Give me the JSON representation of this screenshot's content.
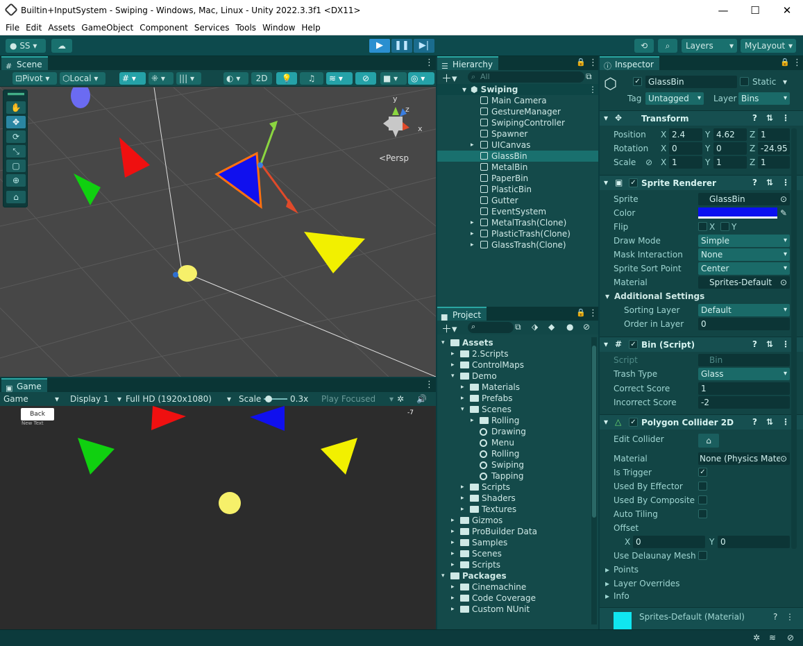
{
  "window": {
    "title": "Builtin+InputSystem - Swiping - Windows, Mac, Linux - Unity 2022.3.3f1 <DX11>"
  },
  "menu": [
    "File",
    "Edit",
    "Assets",
    "GameObject",
    "Component",
    "Services",
    "Tools",
    "Window",
    "Help"
  ],
  "toolbar": {
    "account": "SS",
    "layers": "Layers",
    "layout": "MyLayout"
  },
  "scene": {
    "tab": "Scene",
    "pivot": "Pivot",
    "local": "Local",
    "mode2d": "2D",
    "persp": "<Persp",
    "gizmo_axes": {
      "y": "y",
      "z": "z",
      "x": "x"
    }
  },
  "game": {
    "tab": "Game",
    "mode": "Game",
    "display": "Display 1",
    "resolution": "Full HD (1920x1080)",
    "scale_label": "Scale",
    "scale_value": "0.3x",
    "play_focused": "Play Focused",
    "back_button": "Back",
    "new_text": "New Text",
    "score": "-7"
  },
  "hierarchy": {
    "tab": "Hierarchy",
    "search_placeholder": "All",
    "scene_name": "Swiping",
    "items": [
      {
        "label": "Main Camera",
        "expand": false
      },
      {
        "label": "GestureManager",
        "expand": false
      },
      {
        "label": "SwipingController",
        "expand": false
      },
      {
        "label": "Spawner",
        "expand": false
      },
      {
        "label": "UICanvas",
        "expand": true
      },
      {
        "label": "GlassBin",
        "expand": false,
        "selected": true
      },
      {
        "label": "MetalBin",
        "expand": false
      },
      {
        "label": "PaperBin",
        "expand": false
      },
      {
        "label": "PlasticBin",
        "expand": false
      },
      {
        "label": "Gutter",
        "expand": false
      },
      {
        "label": "EventSystem",
        "expand": false
      },
      {
        "label": "MetalTrash(Clone)",
        "expand": true
      },
      {
        "label": "PlasticTrash(Clone)",
        "expand": true
      },
      {
        "label": "GlassTrash(Clone)",
        "expand": true
      }
    ]
  },
  "project": {
    "tab": "Project",
    "items": [
      {
        "label": "Assets",
        "depth": 0,
        "open": true,
        "kind": "folder"
      },
      {
        "label": "2.Scripts",
        "depth": 1,
        "open": false,
        "kind": "folder"
      },
      {
        "label": "ControlMaps",
        "depth": 1,
        "open": false,
        "kind": "folder"
      },
      {
        "label": "Demo",
        "depth": 1,
        "open": true,
        "kind": "folder"
      },
      {
        "label": "Materials",
        "depth": 2,
        "open": false,
        "kind": "folder"
      },
      {
        "label": "Prefabs",
        "depth": 2,
        "open": false,
        "kind": "folder"
      },
      {
        "label": "Scenes",
        "depth": 2,
        "open": true,
        "kind": "folder"
      },
      {
        "label": "Rolling",
        "depth": 3,
        "open": false,
        "kind": "folder"
      },
      {
        "label": "Drawing",
        "depth": 3,
        "open": false,
        "kind": "scene"
      },
      {
        "label": "Menu",
        "depth": 3,
        "open": false,
        "kind": "scene"
      },
      {
        "label": "Rolling",
        "depth": 3,
        "open": false,
        "kind": "scene"
      },
      {
        "label": "Swiping",
        "depth": 3,
        "open": false,
        "kind": "scene"
      },
      {
        "label": "Tapping",
        "depth": 3,
        "open": false,
        "kind": "scene"
      },
      {
        "label": "Scripts",
        "depth": 2,
        "open": false,
        "kind": "folder"
      },
      {
        "label": "Shaders",
        "depth": 2,
        "open": false,
        "kind": "folder"
      },
      {
        "label": "Textures",
        "depth": 2,
        "open": false,
        "kind": "folder"
      },
      {
        "label": "Gizmos",
        "depth": 1,
        "open": false,
        "kind": "folder"
      },
      {
        "label": "ProBuilder Data",
        "depth": 1,
        "open": false,
        "kind": "folder"
      },
      {
        "label": "Samples",
        "depth": 1,
        "open": false,
        "kind": "folder"
      },
      {
        "label": "Scenes",
        "depth": 1,
        "open": false,
        "kind": "folder"
      },
      {
        "label": "Scripts",
        "depth": 1,
        "open": false,
        "kind": "folder"
      },
      {
        "label": "Packages",
        "depth": 0,
        "open": true,
        "kind": "folder"
      },
      {
        "label": "Cinemachine",
        "depth": 1,
        "open": false,
        "kind": "folder"
      },
      {
        "label": "Code Coverage",
        "depth": 1,
        "open": false,
        "kind": "folder"
      },
      {
        "label": "Custom NUnit",
        "depth": 1,
        "open": false,
        "kind": "folder"
      }
    ]
  },
  "inspector": {
    "tab": "Inspector",
    "object_name": "GlassBin",
    "static_label": "Static",
    "tag_label": "Tag",
    "tag_value": "Untagged",
    "layer_label": "Layer",
    "layer_value": "Bins",
    "transform": {
      "title": "Transform",
      "position": {
        "label": "Position",
        "x": "2.4",
        "y": "4.62",
        "z": "1"
      },
      "rotation": {
        "label": "Rotation",
        "x": "0",
        "y": "0",
        "z": "-24.95"
      },
      "scale": {
        "label": "Scale",
        "x": "1",
        "y": "1",
        "z": "1"
      }
    },
    "sprite_renderer": {
      "title": "Sprite Renderer",
      "sprite_label": "Sprite",
      "sprite_value": "GlassBin",
      "color_label": "Color",
      "color": "#0a10f0",
      "flip_label": "Flip",
      "flip_x": "X",
      "flip_y": "Y",
      "draw_mode_label": "Draw Mode",
      "draw_mode": "Simple",
      "mask_label": "Mask Interaction",
      "mask": "None",
      "sort_point_label": "Sprite Sort Point",
      "sort_point": "Center",
      "material_label": "Material",
      "material": "Sprites-Default",
      "additional": "Additional Settings",
      "sorting_layer_label": "Sorting Layer",
      "sorting_layer": "Default",
      "order_label": "Order in Layer",
      "order": "0"
    },
    "bin_script": {
      "title": "Bin (Script)",
      "script_label": "Script",
      "script_value": "Bin",
      "trash_type_label": "Trash Type",
      "trash_type": "Glass",
      "correct_label": "Correct Score",
      "correct": "1",
      "incorrect_label": "Incorrect Score",
      "incorrect": "-2"
    },
    "polygon_collider": {
      "title": "Polygon Collider 2D",
      "edit_label": "Edit Collider",
      "material_label": "Material",
      "material": "None (Physics Mate",
      "is_trigger_label": "Is Trigger",
      "effector_label": "Used By Effector",
      "composite_label": "Used By Composite",
      "auto_tiling_label": "Auto Tiling",
      "offset_label": "Offset",
      "offset_x": "0",
      "offset_y": "0",
      "delaunay_label": "Use Delaunay Mesh",
      "points": "Points",
      "layer_overrides": "Layer Overrides",
      "info": "Info"
    },
    "material_footer": "Sprites-Default (Material)"
  }
}
